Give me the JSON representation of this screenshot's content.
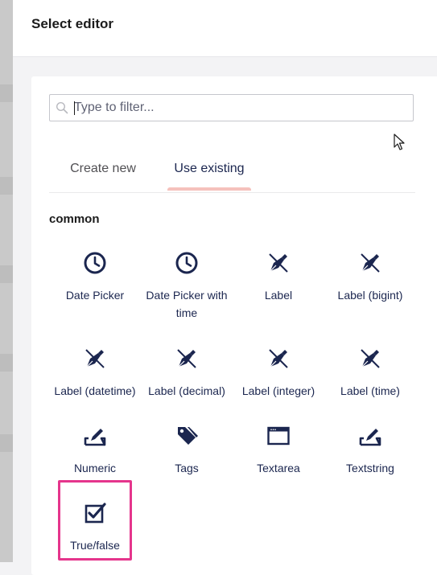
{
  "dialog": {
    "title": "Select editor"
  },
  "search": {
    "placeholder": "Type to filter...",
    "value": ""
  },
  "tabs": [
    {
      "label": "Create new",
      "active": false
    },
    {
      "label": "Use existing",
      "active": true
    }
  ],
  "group": {
    "name": "common",
    "items": [
      {
        "label": "Date Picker",
        "icon": "clock-icon"
      },
      {
        "label": "Date Picker with time",
        "icon": "clock-icon"
      },
      {
        "label": "Label",
        "icon": "pen-nib-icon"
      },
      {
        "label": "Label (bigint)",
        "icon": "pen-nib-icon"
      },
      {
        "label": "Label (datetime)",
        "icon": "pen-nib-icon"
      },
      {
        "label": "Label (decimal)",
        "icon": "pen-nib-icon"
      },
      {
        "label": "Label (integer)",
        "icon": "pen-nib-icon"
      },
      {
        "label": "Label (time)",
        "icon": "pen-nib-icon"
      },
      {
        "label": "Numeric",
        "icon": "edit-field-icon"
      },
      {
        "label": "Tags",
        "icon": "tags-icon"
      },
      {
        "label": "Textarea",
        "icon": "window-icon"
      },
      {
        "label": "Textstring",
        "icon": "edit-field-icon"
      },
      {
        "label": "True/false",
        "icon": "checkbox-icon",
        "highlighted": true
      }
    ]
  },
  "colors": {
    "icon": "#1b264f",
    "accent_underline": "#f5c1bc",
    "highlight": "#e5358c"
  }
}
